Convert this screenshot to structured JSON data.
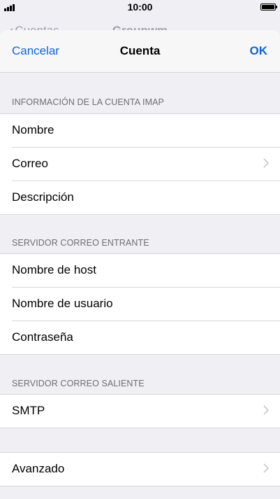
{
  "status_bar": {
    "time": "10:00"
  },
  "background_screen": {
    "back_label": "Cuentas",
    "title": "Groupwm"
  },
  "nav": {
    "cancel_label": "Cancelar",
    "title": "Cuenta",
    "ok_label": "OK"
  },
  "sections": {
    "imap": {
      "header": "INFORMACIÓN DE LA CUENTA IMAP",
      "rows": [
        "Nombre",
        "Correo",
        "Descripción"
      ]
    },
    "incoming": {
      "header": "SERVIDOR CORREO ENTRANTE",
      "rows": [
        "Nombre de host",
        "Nombre de usuario",
        "Contraseña"
      ]
    },
    "outgoing": {
      "header": "SERVIDOR CORREO SALIENTE",
      "rows": [
        "SMTP"
      ]
    },
    "advanced": {
      "rows": [
        "Avanzado"
      ]
    }
  },
  "colors": {
    "accent": "#1164d9",
    "background": "#efeff4",
    "separator": "#d6d6da",
    "header_text": "#6d6d72"
  }
}
